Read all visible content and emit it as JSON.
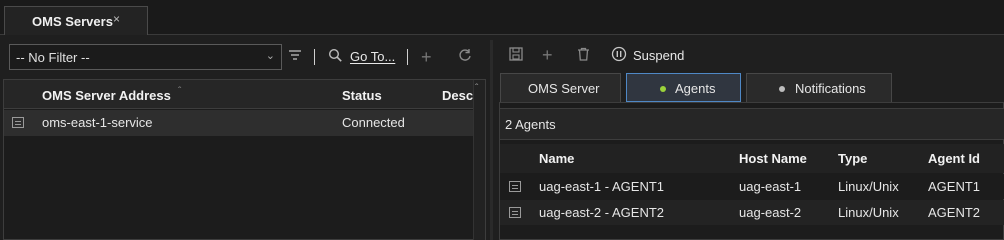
{
  "tab": {
    "title": "OMS Servers",
    "close": "×"
  },
  "left_toolbar": {
    "filter_value": "-- No Filter --",
    "goto_label": "Go To..."
  },
  "left_grid": {
    "columns": [
      "OMS Server Address",
      "Status",
      "Desc"
    ],
    "rows": [
      {
        "address": "oms-east-1-service",
        "status": "Connected"
      }
    ]
  },
  "right_toolbar": {
    "suspend_label": "Suspend"
  },
  "right_tabs": [
    "OMS Server",
    "Agents",
    "Notifications"
  ],
  "agents": {
    "count_label": "2 Agents",
    "columns": [
      "Name",
      "Host Name",
      "Type",
      "Agent Id"
    ],
    "rows": [
      {
        "name": "uag-east-1 - AGENT1",
        "host": "uag-east-1",
        "type": "Linux/Unix",
        "id": "AGENT1"
      },
      {
        "name": "uag-east-2 - AGENT2",
        "host": "uag-east-2",
        "type": "Linux/Unix",
        "id": "AGENT2"
      }
    ]
  },
  "colors": {
    "accent": "#4f88c6",
    "active_dot": "#9bd23b",
    "inactive_dot": "#bdbdbd"
  }
}
